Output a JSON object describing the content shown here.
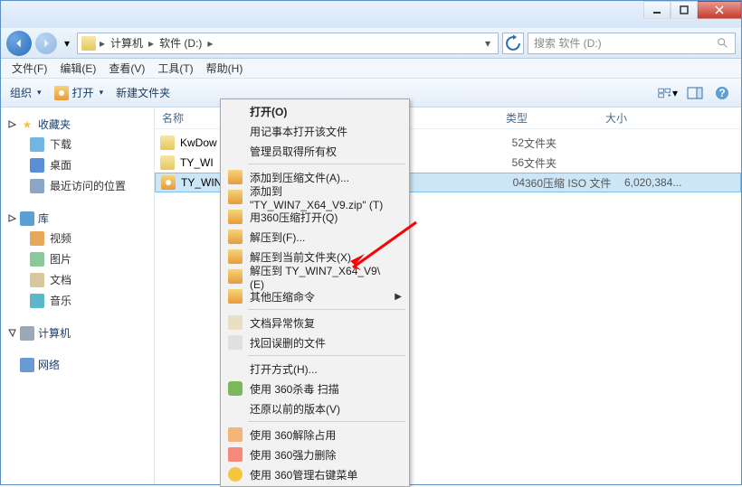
{
  "titlebar": {},
  "nav": {
    "path": [
      "计算机",
      "软件 (D:)"
    ],
    "search_placeholder": "搜索 软件 (D:)"
  },
  "menubar": [
    "文件(F)",
    "编辑(E)",
    "查看(V)",
    "工具(T)",
    "帮助(H)"
  ],
  "toolbar": {
    "organize": "组织",
    "open": "打开",
    "newfolder": "新建文件夹"
  },
  "columns": {
    "name": "名称",
    "type": "类型",
    "size": "大小"
  },
  "sidebar": {
    "fav": {
      "label": "收藏夹",
      "items": [
        {
          "label": "下载",
          "cls": "ico-dl"
        },
        {
          "label": "桌面",
          "cls": "ico-desk"
        },
        {
          "label": "最近访问的位置",
          "cls": "ico-recent"
        }
      ]
    },
    "lib": {
      "label": "库",
      "items": [
        {
          "label": "视频",
          "cls": "ico-video"
        },
        {
          "label": "图片",
          "cls": "ico-pic"
        },
        {
          "label": "文档",
          "cls": "ico-doc"
        },
        {
          "label": "音乐",
          "cls": "ico-music"
        }
      ]
    },
    "pc": {
      "label": "计算机"
    },
    "net": {
      "label": "网络"
    }
  },
  "files": [
    {
      "name": "KwDow",
      "num": "52",
      "type": "文件夹",
      "size": "",
      "cls": "ico-folder",
      "sel": false
    },
    {
      "name": "TY_WI",
      "num": "56",
      "type": "文件夹",
      "size": "",
      "cls": "ico-folder",
      "sel": false
    },
    {
      "name": "TY_WIN",
      "num": "04",
      "type": "360压缩 ISO 文件",
      "size": "6,020,384...",
      "cls": "ico-iso",
      "sel": true
    }
  ],
  "ctx": [
    {
      "label": "打开(O)",
      "bold": true
    },
    {
      "label": "用记事本打开该文件"
    },
    {
      "label": "管理员取得所有权"
    },
    {
      "sep": true
    },
    {
      "label": "添加到压缩文件(A)...",
      "ico": "ci-zip"
    },
    {
      "label": "添加到 \"TY_WIN7_X64_V9.zip\" (T)",
      "ico": "ci-zip"
    },
    {
      "label": "用360压缩打开(Q)",
      "ico": "ci-zip"
    },
    {
      "label": "解压到(F)...",
      "ico": "ci-zip"
    },
    {
      "label": "解压到当前文件夹(X)",
      "ico": "ci-zip"
    },
    {
      "label": "解压到 TY_WIN7_X64_V9\\ (E)",
      "ico": "ci-zip"
    },
    {
      "label": "其他压缩命令",
      "ico": "ci-zip",
      "sub": true
    },
    {
      "sep": true
    },
    {
      "label": "文档异常恢复",
      "ico": "ci-doc"
    },
    {
      "label": "找回误删的文件",
      "ico": "ci-find"
    },
    {
      "sep": true
    },
    {
      "label": "打开方式(H)..."
    },
    {
      "label": "使用 360杀毒 扫描",
      "ico": "ci-shield"
    },
    {
      "label": "还原以前的版本(V)"
    },
    {
      "sep": true
    },
    {
      "label": "使用 360解除占用",
      "ico": "ci-unlock"
    },
    {
      "label": "使用 360强力删除",
      "ico": "ci-del"
    },
    {
      "label": "使用 360管理右键菜单",
      "ico": "ci-menu"
    }
  ]
}
